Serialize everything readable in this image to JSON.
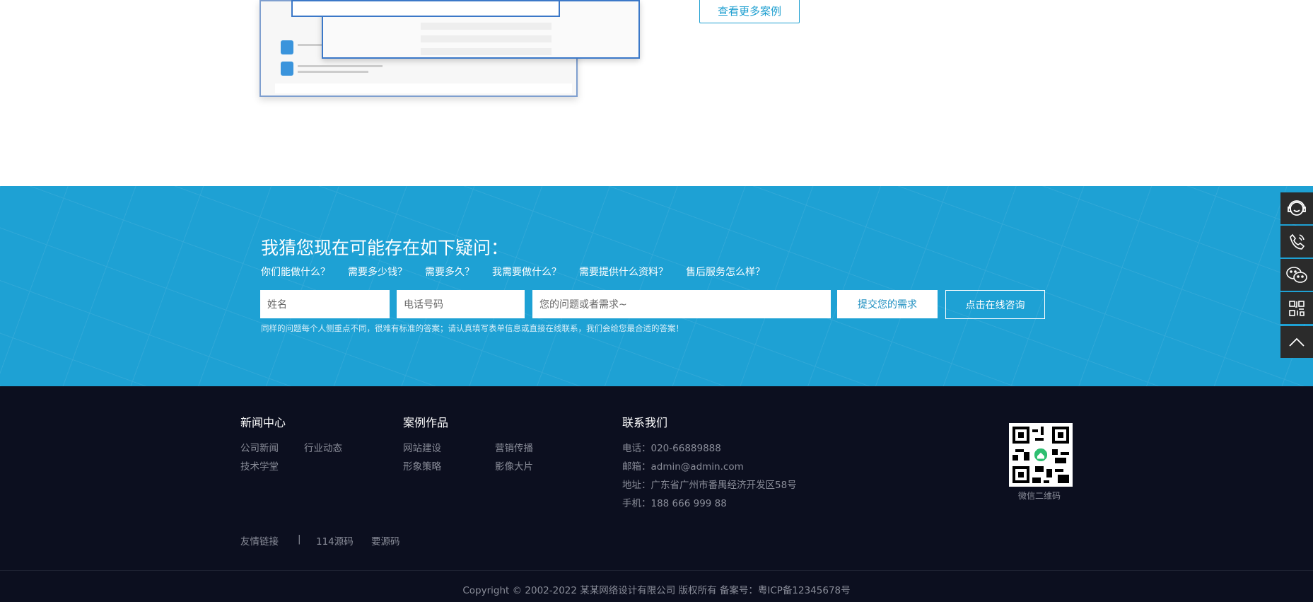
{
  "cases": {
    "more_button": "查看更多案例"
  },
  "question_section": {
    "title": "我猜您现在可能存在如下疑问：",
    "questions": [
      "你们能做什么？",
      "需要多少钱？",
      "需要多久？",
      "我需要做什么？",
      "需要提供什么资料？",
      "售后服务怎么样？"
    ],
    "name_placeholder": "姓名",
    "phone_placeholder": "电话号码",
    "question_placeholder": "您的问题或者需求~",
    "submit_label": "提交您的需求",
    "consult_label": "点击在线咨询",
    "note": "同样的问题每个人侧重点不同，很难有标准的答案；请认真填写表单信息或直接在线联系，我们会给您最合适的答案！",
    "background_color": "#1ea1d4"
  },
  "side_toolbar": {
    "icons": [
      "customer-service-icon",
      "phone-icon",
      "wechat-icon",
      "qrcode-icon",
      "back-to-top-icon"
    ]
  },
  "footer": {
    "news": {
      "heading": "新闻中心",
      "links": [
        "公司新闻",
        "行业动态",
        "技术学堂"
      ]
    },
    "cases": {
      "heading": "案例作品",
      "links": [
        "网站建设",
        "营销传播",
        "形象策略",
        "影像大片"
      ]
    },
    "contact": {
      "heading": "联系我们",
      "lines": [
        "电话：020-66889888",
        "邮箱：admin@admin.com",
        "地址：广东省广州市番禺经济开发区58号",
        "手机：188 666 999 88"
      ]
    },
    "qr_caption": "微信二维码",
    "friend_links": {
      "label": "友情链接",
      "separator": "|",
      "links": [
        "114源码",
        "要源码"
      ]
    },
    "copyright": "Copyright © 2002-2022 某某网络设计有限公司 版权所有   备案号：粤ICP备12345678号",
    "background_color": "#0c0f1f"
  }
}
